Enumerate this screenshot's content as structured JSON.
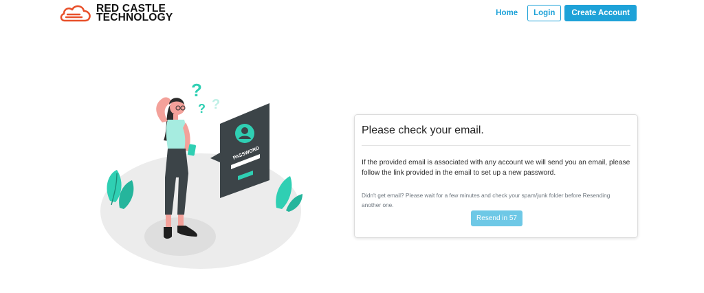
{
  "brand": {
    "line1": "RED CASTLE",
    "line2": "TECHNOLOGY",
    "logo_icon": "cloud-logo-icon",
    "logo_color": "#e8502a"
  },
  "nav": {
    "home": "Home",
    "login": "Login",
    "create_account": "Create Account",
    "accent_color": "#1ea2d8"
  },
  "illustration": {
    "icon": "forgot-password-illustration",
    "panel_label": "PASSWORD"
  },
  "card": {
    "title": "Please check your email.",
    "body": "If the provided email is associated with any account we will send you an email, please follow the link provided in the email to set up a new password.",
    "note": "Didn't get email? Please wait for a few minutes and check your spam/junk folder before Resending another one.",
    "resend_label": "Resend in 57"
  }
}
